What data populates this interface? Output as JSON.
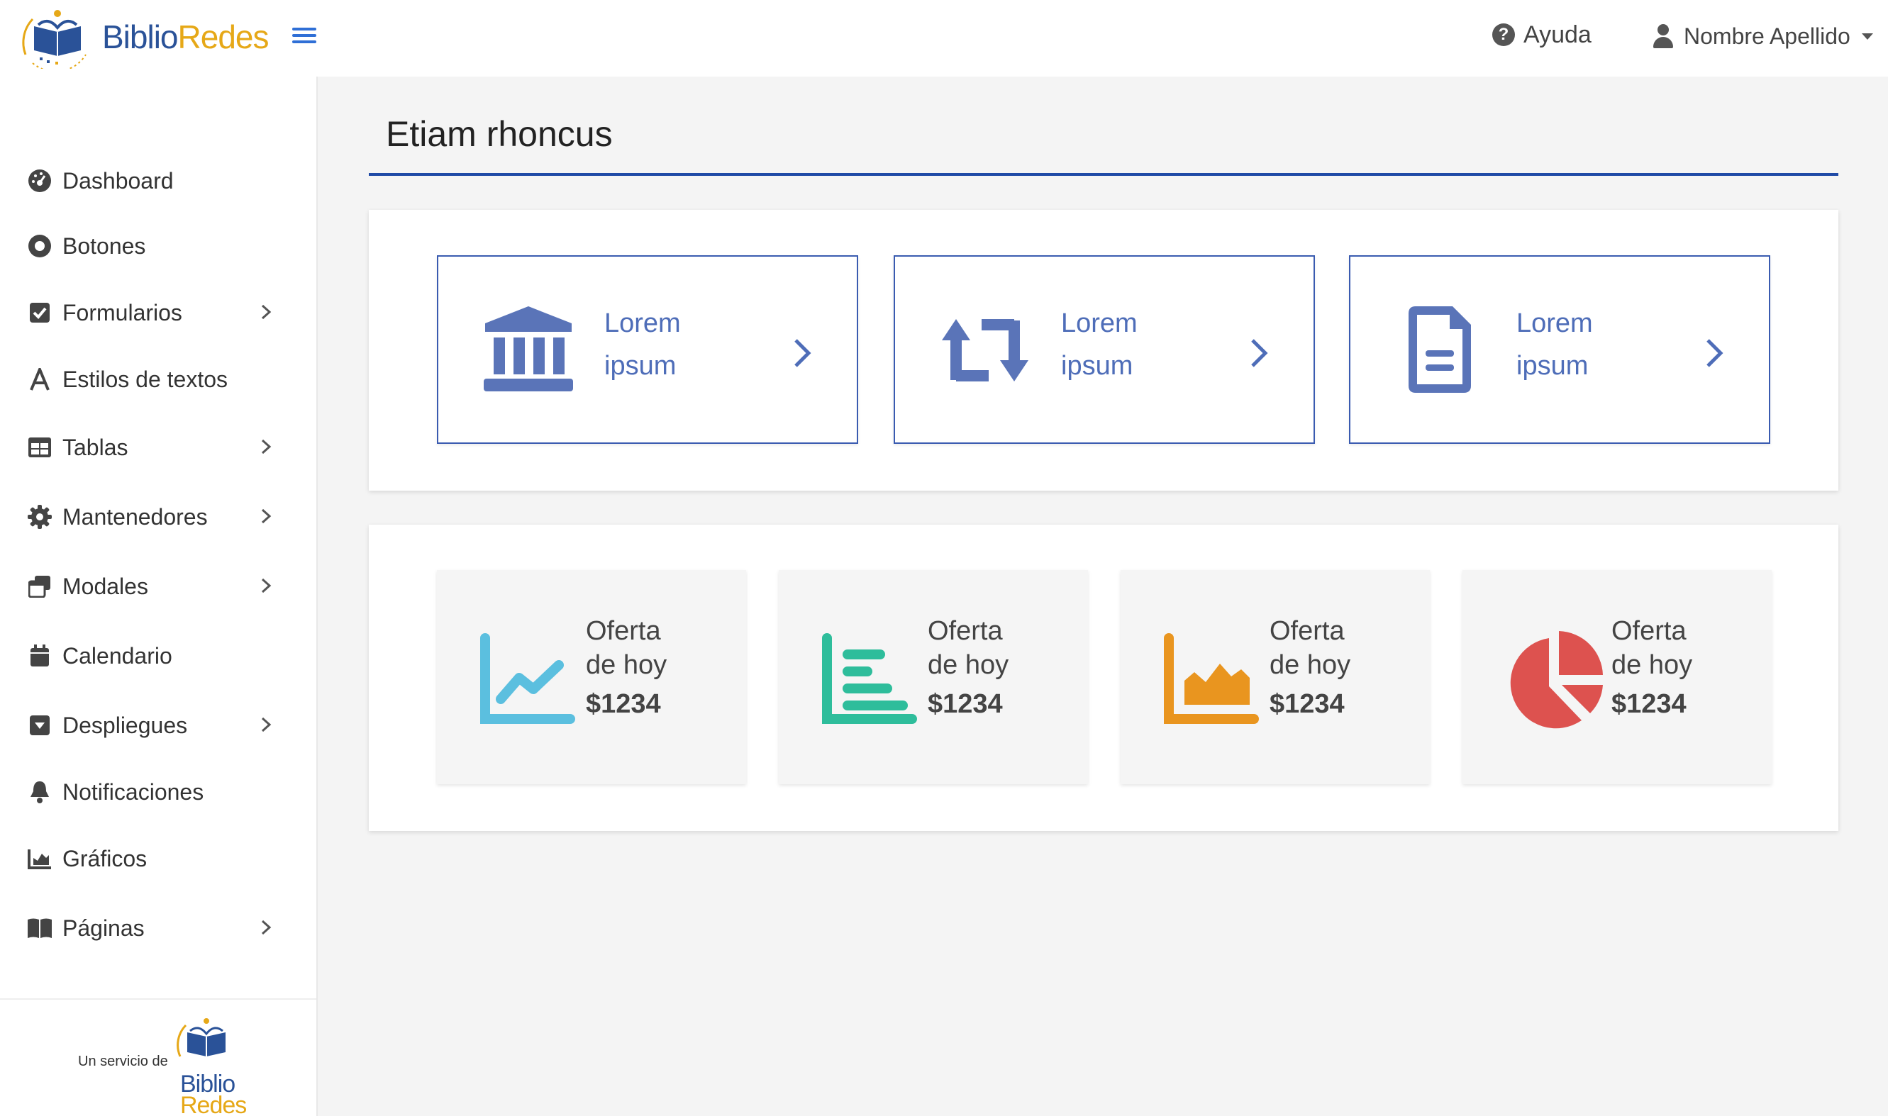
{
  "brand": {
    "name_part1": "Biblio",
    "name_part2": "Redes",
    "blue": "#2a5298",
    "yellow": "#e6a817"
  },
  "header": {
    "help_label": "Ayuda",
    "user_name": "Nombre Apellido",
    "icons": {
      "menu": "hamburger-icon",
      "help": "question-circle-icon",
      "user": "user-icon",
      "caret": "caret-down-icon"
    }
  },
  "sidebar": {
    "items": [
      {
        "label": "Dashboard",
        "icon": "dashboard-icon",
        "has_submenu": false
      },
      {
        "label": "Botones",
        "icon": "circle-dot-icon",
        "has_submenu": false
      },
      {
        "label": "Formularios",
        "icon": "checkbox-icon",
        "has_submenu": true
      },
      {
        "label": "Estilos de textos",
        "icon": "font-icon",
        "has_submenu": false
      },
      {
        "label": "Tablas",
        "icon": "table-icon",
        "has_submenu": true
      },
      {
        "label": "Mantenedores",
        "icon": "gear-icon",
        "has_submenu": true
      },
      {
        "label": "Modales",
        "icon": "windows-icon",
        "has_submenu": true
      },
      {
        "label": "Calendario",
        "icon": "calendar-icon",
        "has_submenu": false
      },
      {
        "label": "Despliegues",
        "icon": "dropdown-box-icon",
        "has_submenu": true
      },
      {
        "label": "Notificaciones",
        "icon": "bell-icon",
        "has_submenu": false
      },
      {
        "label": "Gráficos",
        "icon": "area-chart-icon",
        "has_submenu": false
      },
      {
        "label": "Páginas",
        "icon": "book-icon",
        "has_submenu": true
      }
    ],
    "footer": {
      "service_text": "Un servicio de",
      "logo_line1": "Biblio",
      "logo_line2": "Redes"
    }
  },
  "main": {
    "title": "Etiam rhoncus",
    "link_cards": [
      {
        "line1": "Lorem",
        "line2": "ipsum",
        "icon": "bank-icon"
      },
      {
        "line1": "Lorem",
        "line2": "ipsum",
        "icon": "retweet-icon"
      },
      {
        "line1": "Lorem",
        "line2": "ipsum",
        "icon": "file-text-icon"
      }
    ],
    "stat_cards": [
      {
        "line1": "Oferta",
        "line2": "de hoy",
        "value": "$1234",
        "icon": "line-chart-icon",
        "color": "#5bbfdf"
      },
      {
        "line1": "Oferta",
        "line2": "de hoy",
        "value": "$1234",
        "icon": "bar-chart-icon",
        "color": "#2ebd9b"
      },
      {
        "line1": "Oferta",
        "line2": "de hoy",
        "value": "$1234",
        "icon": "area-chart-icon",
        "color": "#e9951f"
      },
      {
        "line1": "Oferta",
        "line2": "de hoy",
        "value": "$1234",
        "icon": "pie-chart-icon",
        "color": "#dd524f"
      }
    ]
  },
  "colors": {
    "accent": "#1f4aa6",
    "link": "#4e6db8",
    "background": "#f4f4f4"
  }
}
